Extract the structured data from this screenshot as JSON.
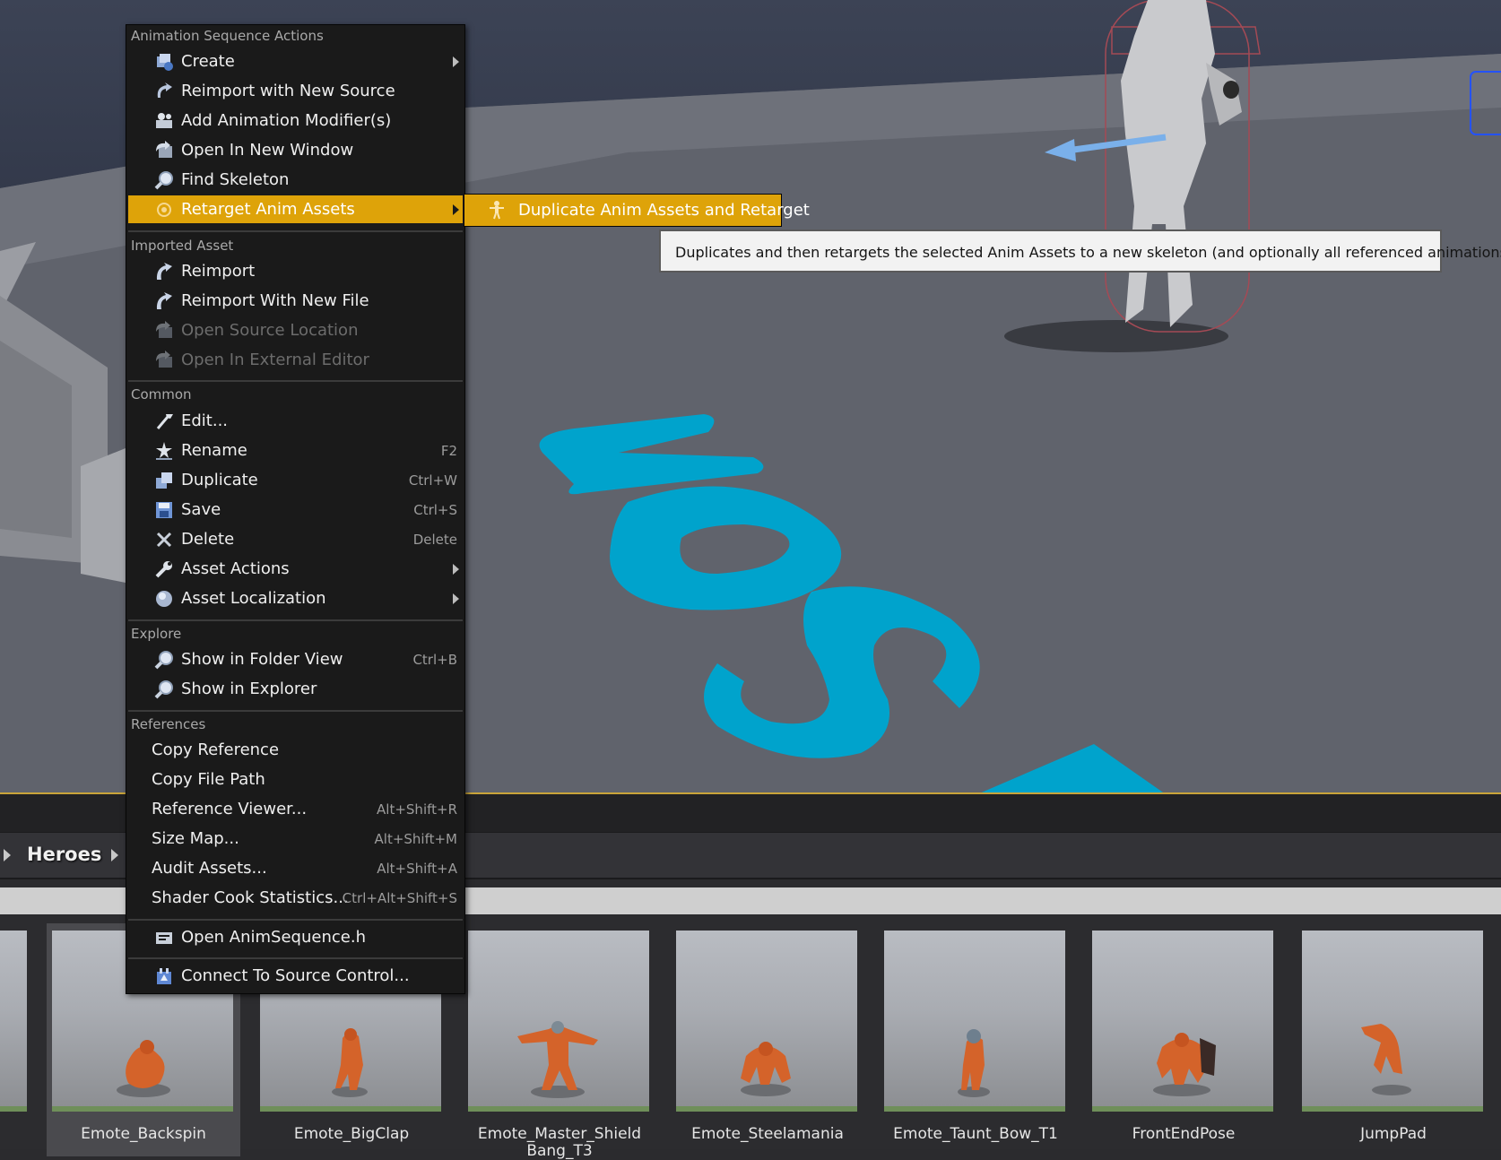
{
  "context_menu": {
    "sections": {
      "animation_sequence_actions": "Animation Sequence Actions",
      "imported_asset": "Imported Asset",
      "common": "Common",
      "explore": "Explore",
      "references": "References"
    },
    "items": {
      "create": {
        "label": "Create",
        "icon": "create-icon"
      },
      "reimport_new_source": {
        "label": "Reimport with New Source",
        "icon": "reimport-source-icon"
      },
      "add_modifier": {
        "label": "Add Animation Modifier(s)",
        "icon": "modifier-icon"
      },
      "open_new_window": {
        "label": "Open In New Window",
        "icon": "open-window-icon"
      },
      "find_skeleton": {
        "label": "Find Skeleton",
        "icon": "magnifier-icon"
      },
      "retarget": {
        "label": "Retarget Anim Assets",
        "icon": "retarget-icon"
      },
      "reimport": {
        "label": "Reimport",
        "icon": "reimport-icon"
      },
      "reimport_new_file": {
        "label": "Reimport With New File",
        "icon": "reimport-file-icon"
      },
      "open_source_location": {
        "label": "Open Source Location",
        "icon": "folder-icon"
      },
      "open_external_editor": {
        "label": "Open In External Editor",
        "icon": "external-editor-icon"
      },
      "edit": {
        "label": "Edit...",
        "icon": "edit-icon"
      },
      "rename": {
        "label": "Rename",
        "shortcut": "F2",
        "icon": "rename-icon"
      },
      "duplicate": {
        "label": "Duplicate",
        "shortcut": "Ctrl+W",
        "icon": "duplicate-icon"
      },
      "save": {
        "label": "Save",
        "shortcut": "Ctrl+S",
        "icon": "save-icon"
      },
      "delete": {
        "label": "Delete",
        "shortcut": "Delete",
        "icon": "delete-icon"
      },
      "asset_actions": {
        "label": "Asset Actions",
        "icon": "wrench-icon"
      },
      "asset_localization": {
        "label": "Asset Localization",
        "icon": "globe-icon"
      },
      "show_folder_view": {
        "label": "Show in Folder View",
        "shortcut": "Ctrl+B",
        "icon": "magnifier-icon"
      },
      "show_explorer": {
        "label": "Show in Explorer",
        "icon": "magnifier-icon"
      },
      "copy_reference": {
        "label": "Copy Reference"
      },
      "copy_file_path": {
        "label": "Copy File Path"
      },
      "reference_viewer": {
        "label": "Reference Viewer...",
        "shortcut": "Alt+Shift+R"
      },
      "size_map": {
        "label": "Size Map...",
        "shortcut": "Alt+Shift+M"
      },
      "audit_assets": {
        "label": "Audit Assets...",
        "shortcut": "Alt+Shift+A"
      },
      "shader_cook": {
        "label": "Shader Cook Statistics...",
        "shortcut": "Ctrl+Alt+Shift+S"
      },
      "open_header": {
        "label": "Open AnimSequence.h",
        "icon": "code-icon"
      },
      "source_control": {
        "label": "Connect To Source Control...",
        "icon": "source-control-icon"
      }
    }
  },
  "submenu": {
    "duplicate_retarget": {
      "label": "Duplicate Anim Assets and Retarget",
      "icon": "mannequin-icon"
    }
  },
  "tooltip": {
    "text": "Duplicates and then retargets the selected Anim Assets to a new skeleton (and optionally all referenced animations too)"
  },
  "content_browser": {
    "breadcrumb": "Heroes",
    "assets": [
      {
        "label": "Emote_Backspin",
        "selected": true
      },
      {
        "label": "Emote_BigClap"
      },
      {
        "label": "Emote_Master_Shield Bang_T3"
      },
      {
        "label": "Emote_Steelamania"
      },
      {
        "label": "Emote_Taunt_Bow_T1"
      },
      {
        "label": "FrontEndPose"
      },
      {
        "label": "JumpPad"
      }
    ]
  },
  "colors": {
    "menu_highlight": "#dea309",
    "menu_bg": "#1a1a1a",
    "floor_logo": "#00a3cc"
  }
}
